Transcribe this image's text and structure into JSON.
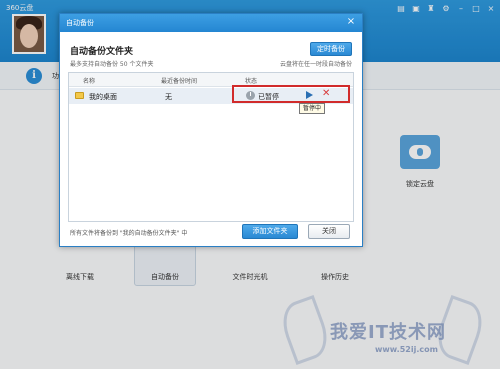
{
  "app": {
    "title": "360云盘",
    "info_text": "功",
    "lock_label": "锁定云盘",
    "tools": [
      {
        "label": "离线下载"
      },
      {
        "label": "自动备份"
      },
      {
        "label": "文件时光机"
      },
      {
        "label": "操作历史"
      }
    ],
    "watermark_text": "我爱IT技术网",
    "watermark_url": "www.52ij.com"
  },
  "dialog": {
    "title": "自动备份",
    "close_glyph": "×",
    "heading": "自动备份文件夹",
    "subtitle": "最多支持自动备份 50 个文件夹",
    "timer_button": "定时备份",
    "note": "云盘将在任一时段自动备份",
    "columns": {
      "name": "名称",
      "last_time": "最近备份时间",
      "status": "状态"
    },
    "rows": [
      {
        "name": "我的桌面",
        "last_time": "无",
        "status": "已暂停"
      }
    ],
    "tooltip": "暂停中",
    "footer_text": "所有文件将备份到 \"我的自动备份文件夹\" 中",
    "add_button": "添加文件夹",
    "close_button": "关闭"
  }
}
